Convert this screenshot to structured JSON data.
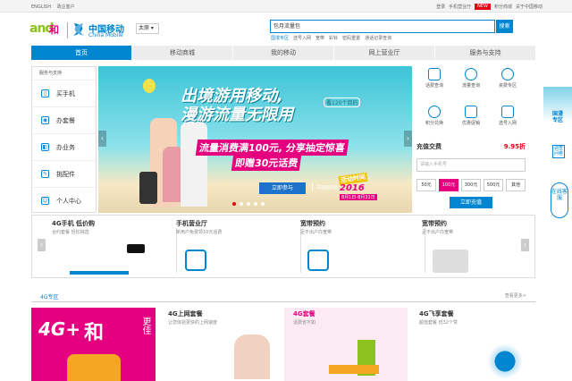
{
  "topbar": {
    "left": [
      "ENGLISH",
      "政企客户"
    ],
    "right": [
      "登录",
      "手机营业厅",
      "积分商城",
      "关于中国移动"
    ],
    "new_badge": "NEW"
  },
  "header": {
    "logo_and": "and",
    "logo_he": "和",
    "logo_cn": "中国移动",
    "logo_en": "China Mobile",
    "city": "太原 ▾",
    "search_value": "包月流量包",
    "search_button": "搜索",
    "hot_words": [
      "国漫专区",
      "选号入网",
      "宽带",
      "彩铃",
      "密码重置",
      "通话记录查询"
    ]
  },
  "nav": [
    "首页",
    "移动商城",
    "我的移动",
    "网上营业厅",
    "服务与支持"
  ],
  "sidemenu": {
    "title": "服务与支持",
    "items": [
      {
        "label": "买手机",
        "icon": "phone-icon"
      },
      {
        "label": "办套餐",
        "icon": "package-icon"
      },
      {
        "label": "办业务",
        "icon": "business-icon"
      },
      {
        "label": "挑配件",
        "icon": "accessory-icon"
      },
      {
        "label": "个人中心",
        "icon": "user-icon"
      }
    ]
  },
  "banner": {
    "title1": "出境游用移动,",
    "title2": "漫游流量无限用",
    "tag": "覆120个目的",
    "line3": "流量消费满100元, 分享抽定惊喜",
    "line4": "即赠30元话费",
    "join": "立即参与",
    "brand": "中国移动",
    "date_tag": "活动时间",
    "year": "2016",
    "date_range": "8月1日-8月31日"
  },
  "services": [
    {
      "label": "话费查询",
      "icon": "bill-icon"
    },
    {
      "label": "流量查询",
      "icon": "traffic-icon"
    },
    {
      "label": "资费专区",
      "icon": "tariff-icon"
    },
    {
      "label": "积分兑换",
      "icon": "points-icon"
    },
    {
      "label": "优惠促销",
      "icon": "promo-icon"
    },
    {
      "label": "选号入网",
      "icon": "number-icon"
    }
  ],
  "recharge": {
    "title": "充值交费",
    "price": "9.95折",
    "placeholder": "请输入手机号",
    "amounts": [
      "50元",
      "100元",
      "300元",
      "500元",
      "其他"
    ],
    "selected_amount": "100元",
    "button": "立即充值"
  },
  "promos": [
    {
      "title": "4G手机 低价购",
      "sub": "合约套餐  轻松挑选"
    },
    {
      "title": "手机营业厅",
      "sub": "新用户免费领10元话费"
    },
    {
      "title": "宽带预约",
      "sub": "足不出户办宽带"
    },
    {
      "title": "宽带预约",
      "sub": "足不出户办宽带"
    }
  ],
  "zone": {
    "title": "4G专区",
    "more": "查看更多>"
  },
  "feature": {
    "text_4g": "4G+",
    "text_he": "和",
    "side": "更佳"
  },
  "cards": [
    {
      "title": "4G上网套餐",
      "sub": "让您体验更快的上网速度"
    },
    {
      "title": "4G套餐",
      "sub": "话费省不如"
    },
    {
      "title": "4G飞享套餐",
      "sub": "超值套餐  低32个赞"
    }
  ],
  "rightbar": {
    "zone": "国漫专区",
    "survey": "调查问卷",
    "online": "在线客服"
  }
}
